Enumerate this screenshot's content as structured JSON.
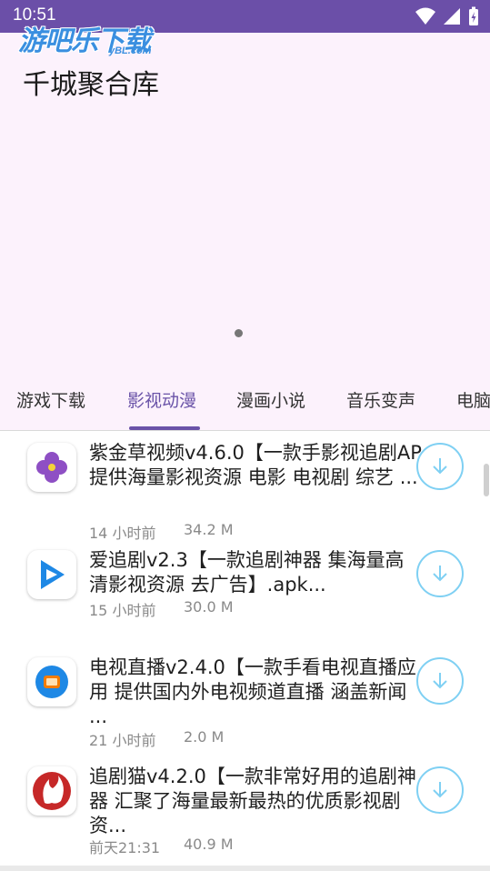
{
  "status_bar": {
    "time": "10:51"
  },
  "watermark": {
    "main": "游吧乐下载",
    "sub": "yBL.com"
  },
  "banner": {
    "title": "千城聚合库"
  },
  "tabs": [
    {
      "label": "游戏下载",
      "active": false
    },
    {
      "label": "影视动漫",
      "active": true
    },
    {
      "label": "漫画小说",
      "active": false
    },
    {
      "label": "音乐变声",
      "active": false
    },
    {
      "label": "电脑",
      "active": false
    }
  ],
  "apps": [
    {
      "icon": "purple-flower-icon",
      "title": "紫金草视频v4.6.0【一款手影视追剧AP 提供海量影视资源 电影 电视剧 综艺 ...",
      "time": "14 小时前",
      "size": "34.2 M"
    },
    {
      "icon": "blue-play-icon",
      "title": "爱追剧v2.3【一款追剧神器 集海量高清影视资源 去广告】.apk...",
      "time": "15 小时前",
      "size": "30.0 M"
    },
    {
      "icon": "tv-icon",
      "title": "电视直播v2.4.0【一款手看电视直播应用 提供国内外电视频道直播 涵盖新闻 ...",
      "time": "21 小时前",
      "size": "2.0 M"
    },
    {
      "icon": "red-cat-icon",
      "title": "追剧猫v4.2.0【一款非常好用的追剧神器 汇聚了海量最新最热的优质影视剧资...",
      "time": "前天21:31",
      "size": "40.9 M"
    }
  ],
  "colors": {
    "status_bar": "#6b4fa8",
    "accent": "#6a53a8",
    "banner_bg": "#fcf2fc",
    "download": "#7fd0f3"
  }
}
